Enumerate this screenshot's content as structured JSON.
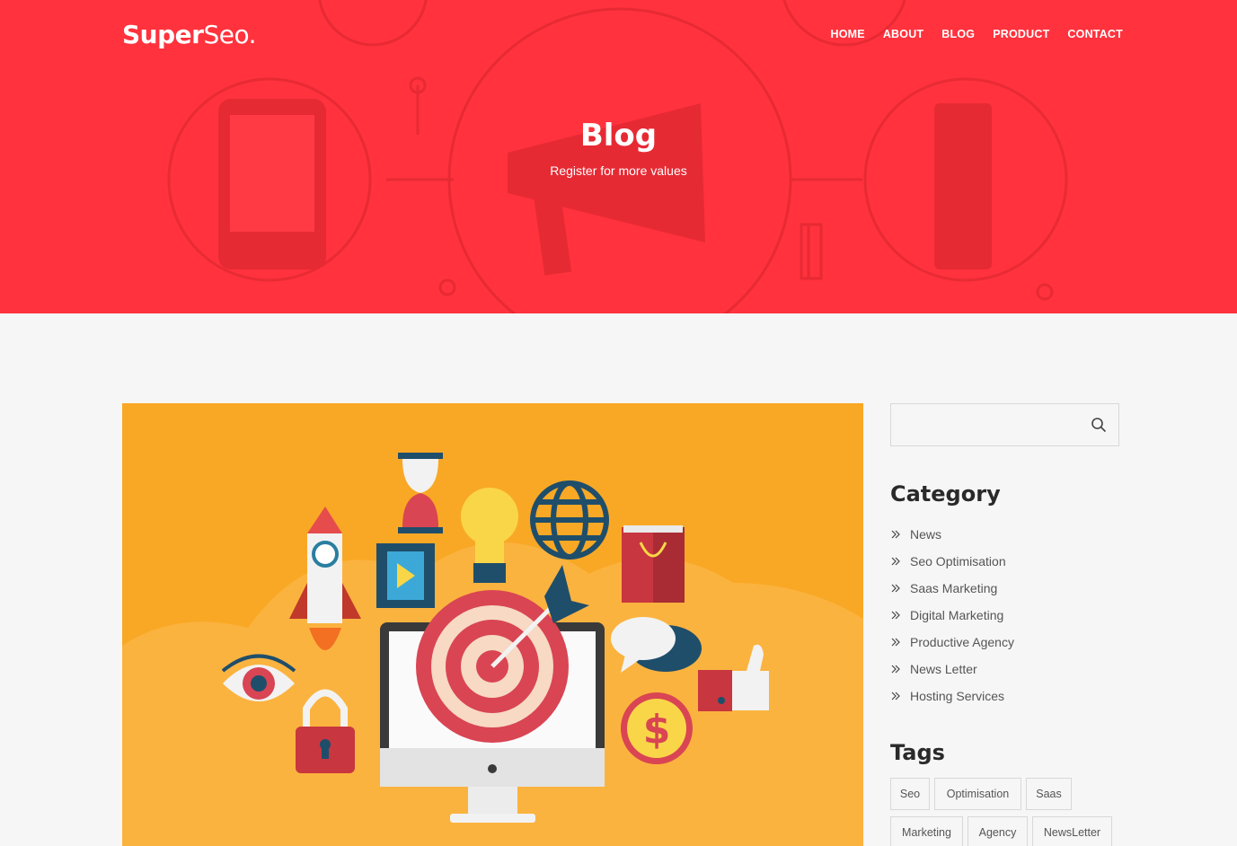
{
  "brand": {
    "logo_bold": "Super",
    "logo_light": "Seo."
  },
  "nav": [
    "HOME",
    "ABOUT",
    "BLOG",
    "PRODUCT",
    "CONTACT"
  ],
  "hero": {
    "title": "Blog",
    "subtitle": "Register for more values"
  },
  "colors": {
    "hero_bg": "#ff323d",
    "feature_bg": "#f9a825",
    "page_bg": "#f6f6f6"
  },
  "sidebar": {
    "search": {
      "placeholder": "",
      "icon": "search-icon"
    },
    "category_title": "Category",
    "categories": [
      "News",
      "Seo Optimisation",
      "Saas Marketing",
      "Digital Marketing",
      "Productive Agency",
      "News Letter",
      "Hosting Services"
    ],
    "tags_title": "Tags",
    "tags": [
      "Seo",
      "Optimisation",
      "Saas",
      "Marketing",
      "Agency",
      "NewsLetter"
    ]
  }
}
